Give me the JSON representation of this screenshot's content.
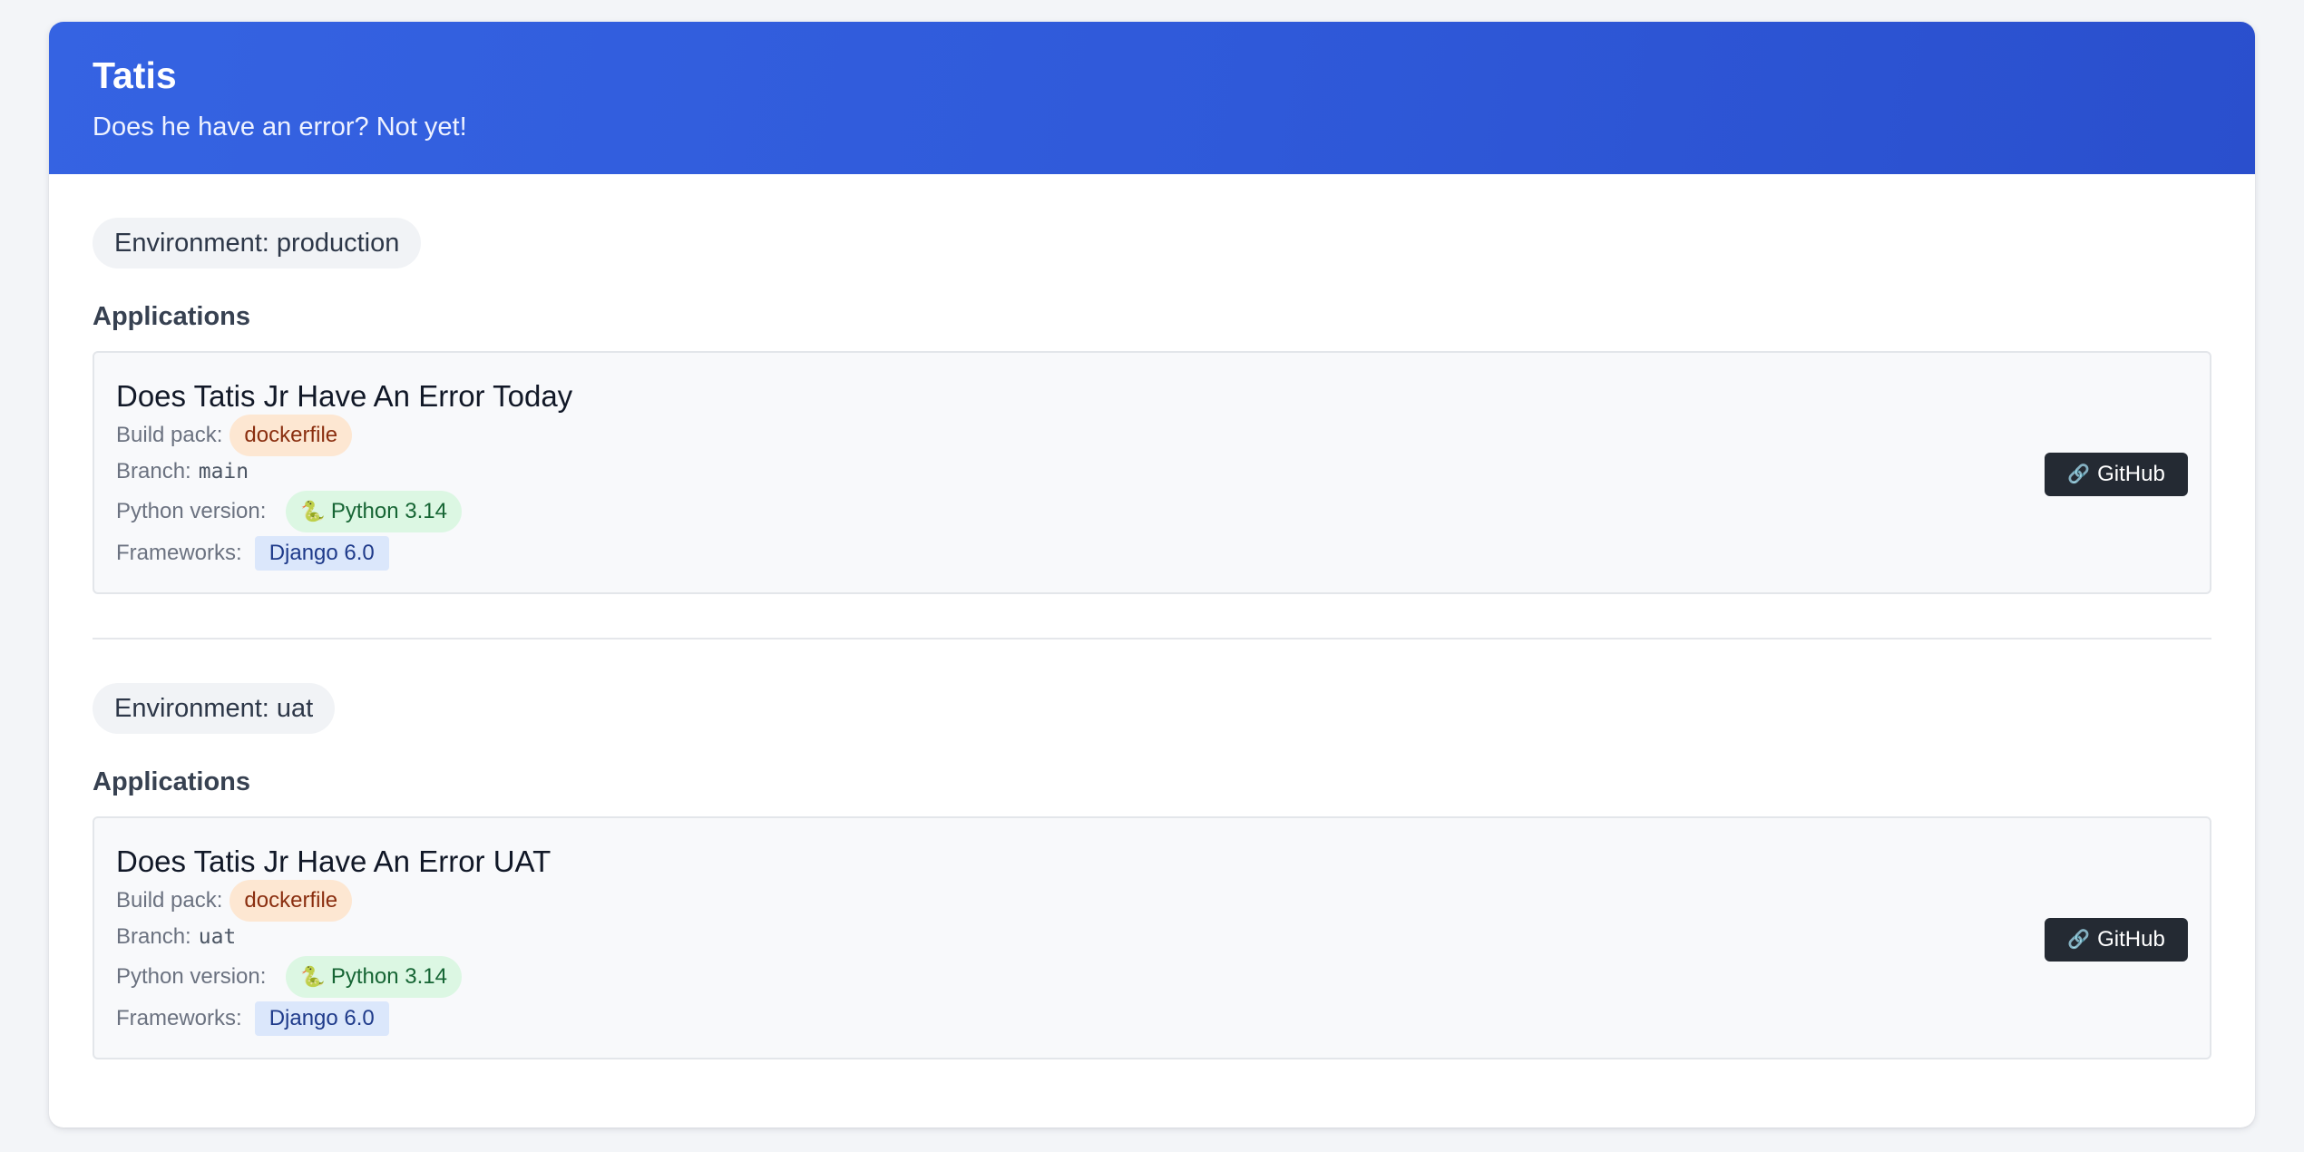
{
  "header": {
    "title": "Tatis",
    "subtitle": "Does he have an error? Not yet!"
  },
  "environments": [
    {
      "label": "Environment: production",
      "apps_heading": "Applications",
      "app": {
        "name": "Does Tatis Jr Have An Error Today",
        "build_pack_label": "Build pack:",
        "build_pack": "dockerfile",
        "branch_label": "Branch:",
        "branch": "main",
        "python_label": "Python version:",
        "python_icon": "snake-icon",
        "python_version": "Python 3.14",
        "frameworks_label": "Frameworks:",
        "framework": "Django 6.0",
        "github_icon": "link-icon",
        "github_label": "GitHub"
      }
    },
    {
      "label": "Environment: uat",
      "apps_heading": "Applications",
      "app": {
        "name": "Does Tatis Jr Have An Error UAT",
        "build_pack_label": "Build pack:",
        "build_pack": "dockerfile",
        "branch_label": "Branch:",
        "branch": "uat",
        "python_label": "Python version:",
        "python_icon": "snake-icon",
        "python_version": "Python 3.14",
        "frameworks_label": "Frameworks:",
        "framework": "Django 6.0",
        "github_icon": "link-icon",
        "github_label": "GitHub"
      }
    }
  ],
  "colors": {
    "header_gradient_start": "#3563e2",
    "header_gradient_end": "#2a4fcd",
    "github_button": "#242a33",
    "build_pack_badge": "#fde7d2",
    "python_badge": "#dcf7e3",
    "framework_badge": "#dbe7fb"
  }
}
